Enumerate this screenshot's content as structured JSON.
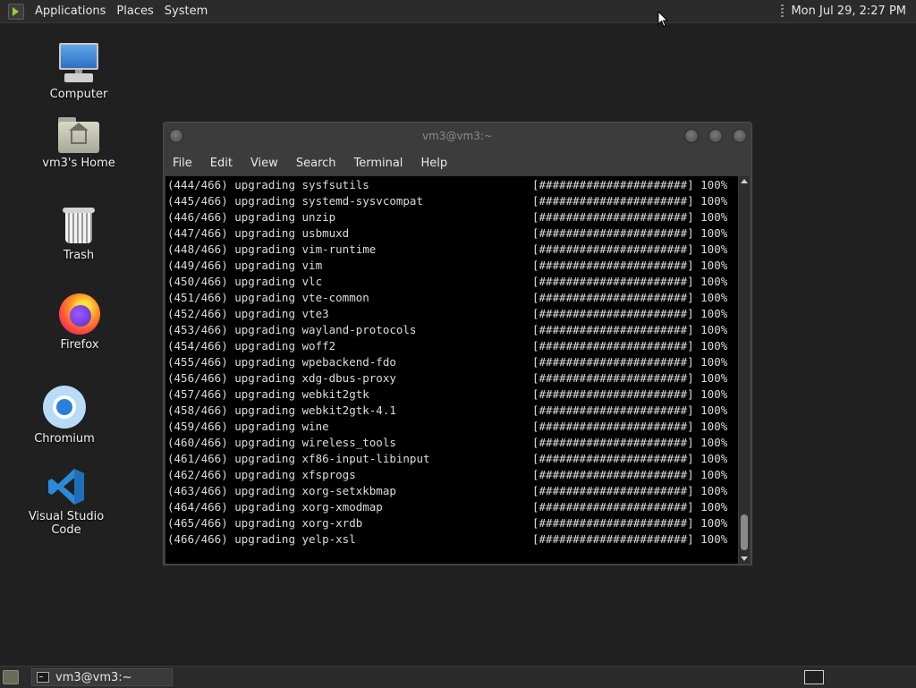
{
  "top_panel": {
    "menus": [
      "Applications",
      "Places",
      "System"
    ],
    "clock": "Mon Jul 29,  2:27 PM"
  },
  "desktop_icons": [
    {
      "label": "Computer",
      "icon": "computer-icon"
    },
    {
      "label": "vm3's Home",
      "icon": "home-folder-icon"
    },
    {
      "label": "Trash",
      "icon": "trash-icon"
    },
    {
      "label": "Firefox",
      "icon": "firefox-icon"
    },
    {
      "label": "Chromium",
      "icon": "chromium-icon"
    },
    {
      "label": "Visual Studio Code",
      "icon": "vscode-icon"
    }
  ],
  "terminal": {
    "title": "vm3@vm3:~",
    "menus": [
      "File",
      "Edit",
      "View",
      "Search",
      "Terminal",
      "Help"
    ],
    "progress_bar": "[######################] 100%",
    "lines": [
      "(444/466) upgrading sysfsutils",
      "(445/466) upgrading systemd-sysvcompat",
      "(446/466) upgrading unzip",
      "(447/466) upgrading usbmuxd",
      "(448/466) upgrading vim-runtime",
      "(449/466) upgrading vim",
      "(450/466) upgrading vlc",
      "(451/466) upgrading vte-common",
      "(452/466) upgrading vte3",
      "(453/466) upgrading wayland-protocols",
      "(454/466) upgrading woff2",
      "(455/466) upgrading wpebackend-fdo",
      "(456/466) upgrading xdg-dbus-proxy",
      "(457/466) upgrading webkit2gtk",
      "(458/466) upgrading webkit2gtk-4.1",
      "(459/466) upgrading wine",
      "(460/466) upgrading wireless_tools",
      "(461/466) upgrading xf86-input-libinput",
      "(462/466) upgrading xfsprogs",
      "(463/466) upgrading xorg-setxkbmap",
      "(464/466) upgrading xorg-xmodmap",
      "(465/466) upgrading xorg-xrdb",
      "(466/466) upgrading yelp-xsl"
    ]
  },
  "taskbar": {
    "task_label": "vm3@vm3:~"
  },
  "colors": {
    "desktop_bg": "#202020",
    "panel_bg": "#2b2b2b",
    "terminal_bg": "#000000",
    "terminal_fg": "#dcdcdc"
  }
}
